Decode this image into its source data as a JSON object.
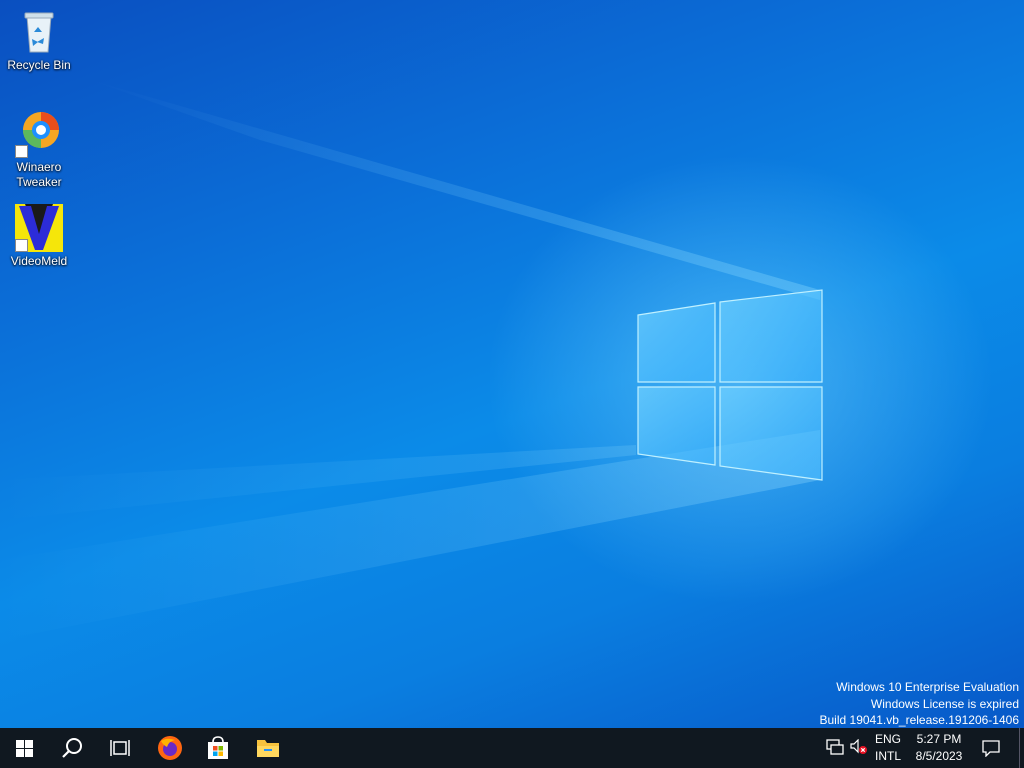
{
  "desktop": {
    "icons": [
      {
        "label": "Recycle Bin",
        "icon": "recycle-bin-icon"
      },
      {
        "label": "Winaero Tweaker",
        "icon": "winaero-tweaker-icon"
      },
      {
        "label": "VideoMeld",
        "icon": "videomeld-icon"
      }
    ]
  },
  "watermark": {
    "line1": "Windows 10 Enterprise Evaluation",
    "line2": "Windows License is expired",
    "line3": "Build 19041.vb_release.191206-1406"
  },
  "taskbar": {
    "pinned": [
      {
        "name": "start",
        "icon": "windows-start-icon"
      },
      {
        "name": "search",
        "icon": "search-icon"
      },
      {
        "name": "task-view",
        "icon": "task-view-icon"
      },
      {
        "name": "firefox",
        "icon": "firefox-icon"
      },
      {
        "name": "microsoft-store",
        "icon": "store-icon"
      },
      {
        "name": "file-explorer",
        "icon": "folder-icon"
      }
    ],
    "tray": {
      "network_icon": "network-icon",
      "volume_icon": "volume-muted-icon",
      "language_line1": "ENG",
      "language_line2": "INTL",
      "time": "5:27 PM",
      "date": "8/5/2023",
      "notifications_icon": "action-center-icon"
    }
  },
  "colors": {
    "taskbar": "#101820",
    "wallpaper_main": "#0b7fe0",
    "accent": "#0078d7"
  }
}
